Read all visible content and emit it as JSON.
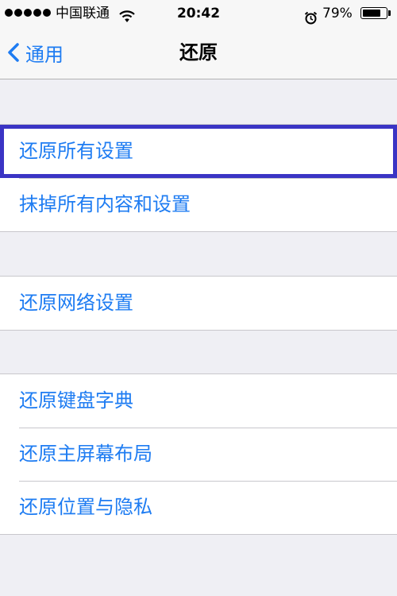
{
  "status_bar": {
    "carrier": "中国联通",
    "time": "20:42",
    "battery": "79%",
    "battery_level": 0.79
  },
  "nav": {
    "back_label": "通用",
    "title": "还原"
  },
  "groups": [
    {
      "items": [
        {
          "label": "还原所有设置",
          "highlighted": true
        },
        {
          "label": "抹掉所有内容和设置"
        }
      ]
    },
    {
      "items": [
        {
          "label": "还原网络设置"
        }
      ]
    },
    {
      "items": [
        {
          "label": "还原键盘字典"
        },
        {
          "label": "还原主屏幕布局"
        },
        {
          "label": "还原位置与隐私"
        }
      ]
    }
  ],
  "colors": {
    "accent": "#1e7cf2",
    "highlight_frame": "#3a34c4",
    "background": "#efeff4"
  }
}
